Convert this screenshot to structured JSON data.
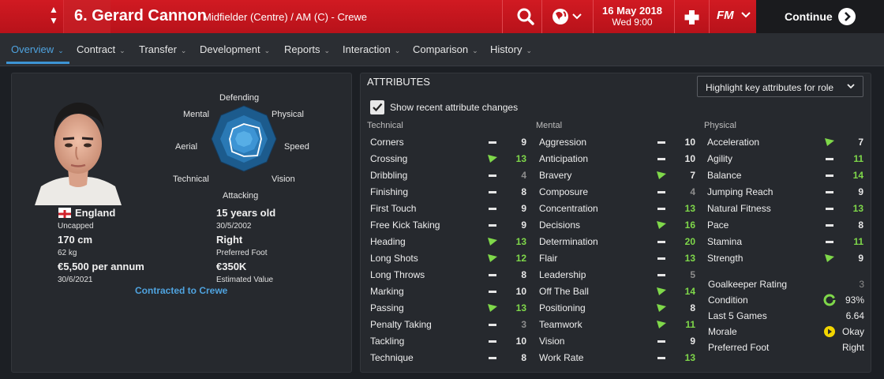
{
  "header": {
    "player_title": "6. Gerard Cannon",
    "player_subtitle": "Midfielder (Centre) / AM (C) - Crewe",
    "date_line1": "16 May 2018",
    "date_line2": "Wed 9:00",
    "fm_label": "FM",
    "continue_label": "Continue",
    "brand_color": "#c8161e"
  },
  "nav": {
    "tabs": [
      {
        "label": "Overview"
      },
      {
        "label": "Contract"
      },
      {
        "label": "Transfer"
      },
      {
        "label": "Development"
      },
      {
        "label": "Reports"
      },
      {
        "label": "Interaction"
      },
      {
        "label": "Comparison"
      },
      {
        "label": "History"
      }
    ],
    "active": "Overview"
  },
  "profile": {
    "radar_labels": {
      "defending": "Defending",
      "physical": "Physical",
      "speed": "Speed",
      "vision": "Vision",
      "attacking": "Attacking",
      "technical": "Technical",
      "aerial": "Aerial",
      "mental": "Mental"
    },
    "nationality": "England",
    "caps": "Uncapped",
    "height": "170 cm",
    "weight": "62 kg",
    "wage": "€5,500 per annum",
    "contract_end": "30/6/2021",
    "age": "15 years old",
    "dob": "30/5/2002",
    "foot": "Right",
    "foot_label": "Preferred Foot",
    "value": "€350K",
    "value_label": "Estimated Value",
    "contract_text": "Contracted to Crewe"
  },
  "attributes": {
    "heading": "ATTRIBUTES",
    "highlight_label": "Highlight key attributes for role",
    "recent_changes_label": "Show recent attribute changes",
    "recent_changes_checked": true,
    "columns": [
      {
        "title": "Technical",
        "items": [
          {
            "name": "Corners",
            "value": "9",
            "trend": "same",
            "color": "normal"
          },
          {
            "name": "Crossing",
            "value": "13",
            "trend": "up",
            "color": "green"
          },
          {
            "name": "Dribbling",
            "value": "4",
            "trend": "same",
            "color": "dim"
          },
          {
            "name": "Finishing",
            "value": "8",
            "trend": "same",
            "color": "normal"
          },
          {
            "name": "First Touch",
            "value": "9",
            "trend": "same",
            "color": "normal"
          },
          {
            "name": "Free Kick Taking",
            "value": "9",
            "trend": "same",
            "color": "normal"
          },
          {
            "name": "Heading",
            "value": "13",
            "trend": "up",
            "color": "green"
          },
          {
            "name": "Long Shots",
            "value": "12",
            "trend": "up",
            "color": "green"
          },
          {
            "name": "Long Throws",
            "value": "8",
            "trend": "same",
            "color": "normal"
          },
          {
            "name": "Marking",
            "value": "10",
            "trend": "same",
            "color": "normal"
          },
          {
            "name": "Passing",
            "value": "13",
            "trend": "up",
            "color": "green"
          },
          {
            "name": "Penalty Taking",
            "value": "3",
            "trend": "same",
            "color": "dim"
          },
          {
            "name": "Tackling",
            "value": "10",
            "trend": "same",
            "color": "normal"
          },
          {
            "name": "Technique",
            "value": "8",
            "trend": "same",
            "color": "normal"
          }
        ]
      },
      {
        "title": "Mental",
        "items": [
          {
            "name": "Aggression",
            "value": "10",
            "trend": "same",
            "color": "normal"
          },
          {
            "name": "Anticipation",
            "value": "10",
            "trend": "same",
            "color": "normal"
          },
          {
            "name": "Bravery",
            "value": "7",
            "trend": "up",
            "color": "normal"
          },
          {
            "name": "Composure",
            "value": "4",
            "trend": "same",
            "color": "dim"
          },
          {
            "name": "Concentration",
            "value": "13",
            "trend": "same",
            "color": "green"
          },
          {
            "name": "Decisions",
            "value": "16",
            "trend": "up",
            "color": "green"
          },
          {
            "name": "Determination",
            "value": "20",
            "trend": "same",
            "color": "green"
          },
          {
            "name": "Flair",
            "value": "13",
            "trend": "same",
            "color": "green"
          },
          {
            "name": "Leadership",
            "value": "5",
            "trend": "same",
            "color": "dim"
          },
          {
            "name": "Off The Ball",
            "value": "14",
            "trend": "up",
            "color": "green"
          },
          {
            "name": "Positioning",
            "value": "8",
            "trend": "up",
            "color": "normal"
          },
          {
            "name": "Teamwork",
            "value": "11",
            "trend": "up",
            "color": "green"
          },
          {
            "name": "Vision",
            "value": "9",
            "trend": "same",
            "color": "normal"
          },
          {
            "name": "Work Rate",
            "value": "13",
            "trend": "same",
            "color": "green"
          }
        ]
      },
      {
        "title": "Physical",
        "items": [
          {
            "name": "Acceleration",
            "value": "7",
            "trend": "up",
            "color": "normal"
          },
          {
            "name": "Agility",
            "value": "11",
            "trend": "same",
            "color": "green"
          },
          {
            "name": "Balance",
            "value": "14",
            "trend": "same",
            "color": "green"
          },
          {
            "name": "Jumping Reach",
            "value": "9",
            "trend": "same",
            "color": "normal"
          },
          {
            "name": "Natural Fitness",
            "value": "13",
            "trend": "same",
            "color": "green"
          },
          {
            "name": "Pace",
            "value": "8",
            "trend": "same",
            "color": "normal"
          },
          {
            "name": "Stamina",
            "value": "11",
            "trend": "same",
            "color": "green"
          },
          {
            "name": "Strength",
            "value": "9",
            "trend": "up",
            "color": "normal"
          }
        ]
      }
    ],
    "stats": [
      {
        "name": "Goalkeeper Rating",
        "value": "3"
      },
      {
        "name": "Condition",
        "value": "93%"
      },
      {
        "name": "Last 5 Games",
        "value": "6.64"
      },
      {
        "name": "Morale",
        "value": "Okay"
      },
      {
        "name": "Preferred Foot",
        "value": "Right"
      }
    ]
  }
}
